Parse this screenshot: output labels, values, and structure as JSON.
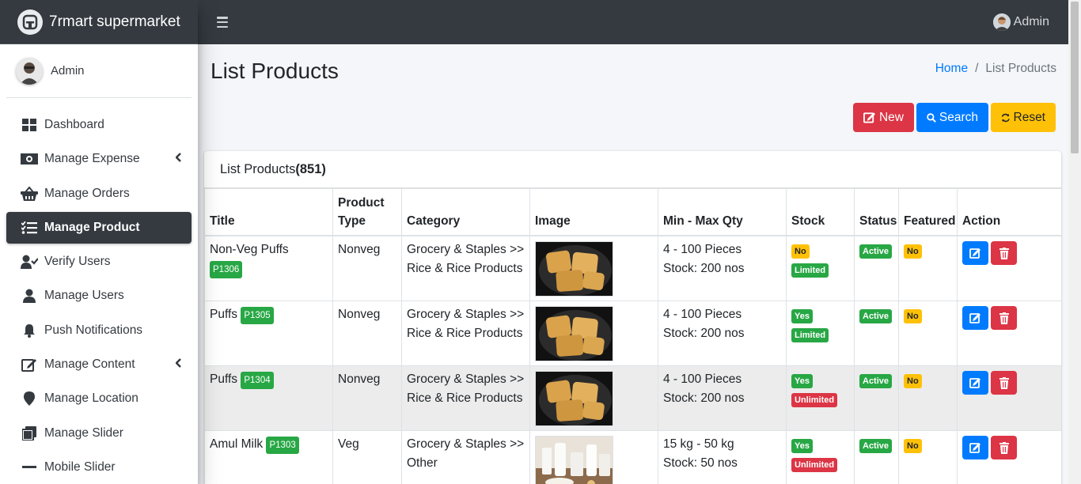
{
  "brand": {
    "name": "7rmart supermarket"
  },
  "sidebar": {
    "user": "Admin",
    "items": [
      {
        "label": "Dashboard",
        "icon": "dashboard-icon"
      },
      {
        "label": "Manage Expense",
        "icon": "money-icon",
        "has_submenu": true
      },
      {
        "label": "Manage Orders",
        "icon": "basket-icon"
      },
      {
        "label": "Manage Product",
        "icon": "list-icon",
        "active": true
      },
      {
        "label": "Verify Users",
        "icon": "user-check-icon"
      },
      {
        "label": "Manage Users",
        "icon": "user-icon"
      },
      {
        "label": "Push Notifications",
        "icon": "bell-icon"
      },
      {
        "label": "Manage Content",
        "icon": "edit-icon",
        "has_submenu": true
      },
      {
        "label": "Manage Location",
        "icon": "map-marker-icon"
      },
      {
        "label": "Manage Slider",
        "icon": "slider-icon"
      },
      {
        "label": "Mobile Slider",
        "icon": "minus-icon"
      }
    ]
  },
  "topbar": {
    "user": "Admin"
  },
  "page": {
    "title": "List Products",
    "breadcrumb": {
      "home": "Home",
      "separator": "/",
      "current": "List Products"
    }
  },
  "actions": {
    "new": "New",
    "search": "Search",
    "reset": "Reset"
  },
  "card": {
    "title": "List Products",
    "count": "(851)"
  },
  "table": {
    "headers": [
      "Title",
      "Product Type",
      "Category",
      "Image",
      "Min - Max Qty",
      "Stock",
      "Status",
      "Featured",
      "Action"
    ],
    "rows": [
      {
        "title": "Non-Veg Puffs",
        "code": "P1306",
        "type": "Nonveg",
        "category_1": "Grocery & Staples >>",
        "category_2": "Rice & Rice Products",
        "image": "puffs",
        "qty": "4 - 100 Pieces",
        "stock_text": "Stock: 200 nos",
        "stock_flag": "No",
        "stock_limit": "Limited",
        "status": "Active",
        "featured": "No"
      },
      {
        "title": "Puffs",
        "code": "P1305",
        "type": "Nonveg",
        "category_1": "Grocery & Staples >>",
        "category_2": "Rice & Rice Products",
        "image": "puffs",
        "qty": "4 - 100 Pieces",
        "stock_text": "Stock: 200 nos",
        "stock_flag": "Yes",
        "stock_limit": "Limited",
        "status": "Active",
        "featured": "No"
      },
      {
        "title": "Puffs",
        "code": "P1304",
        "type": "Nonveg",
        "category_1": "Grocery & Staples >>",
        "category_2": "Rice & Rice Products",
        "image": "puffs",
        "qty": "4 - 100 Pieces",
        "stock_text": "Stock: 200 nos",
        "stock_flag": "Yes",
        "stock_limit": "Unlimited",
        "status": "Active",
        "featured": "No"
      },
      {
        "title": "Amul Milk",
        "code": "P1303",
        "type": "Veg",
        "category_1": "Grocery & Staples >>",
        "category_2": "Other",
        "image": "milk",
        "qty": "15 kg - 50 kg",
        "stock_text": "Stock: 50 nos",
        "stock_flag": "Yes",
        "stock_limit": "Unlimited",
        "status": "Active",
        "featured": "No"
      }
    ]
  },
  "colors": {
    "dark": "#343a40",
    "primary": "#007bff",
    "danger": "#dc3545",
    "warning": "#ffc107",
    "success": "#28a745"
  }
}
